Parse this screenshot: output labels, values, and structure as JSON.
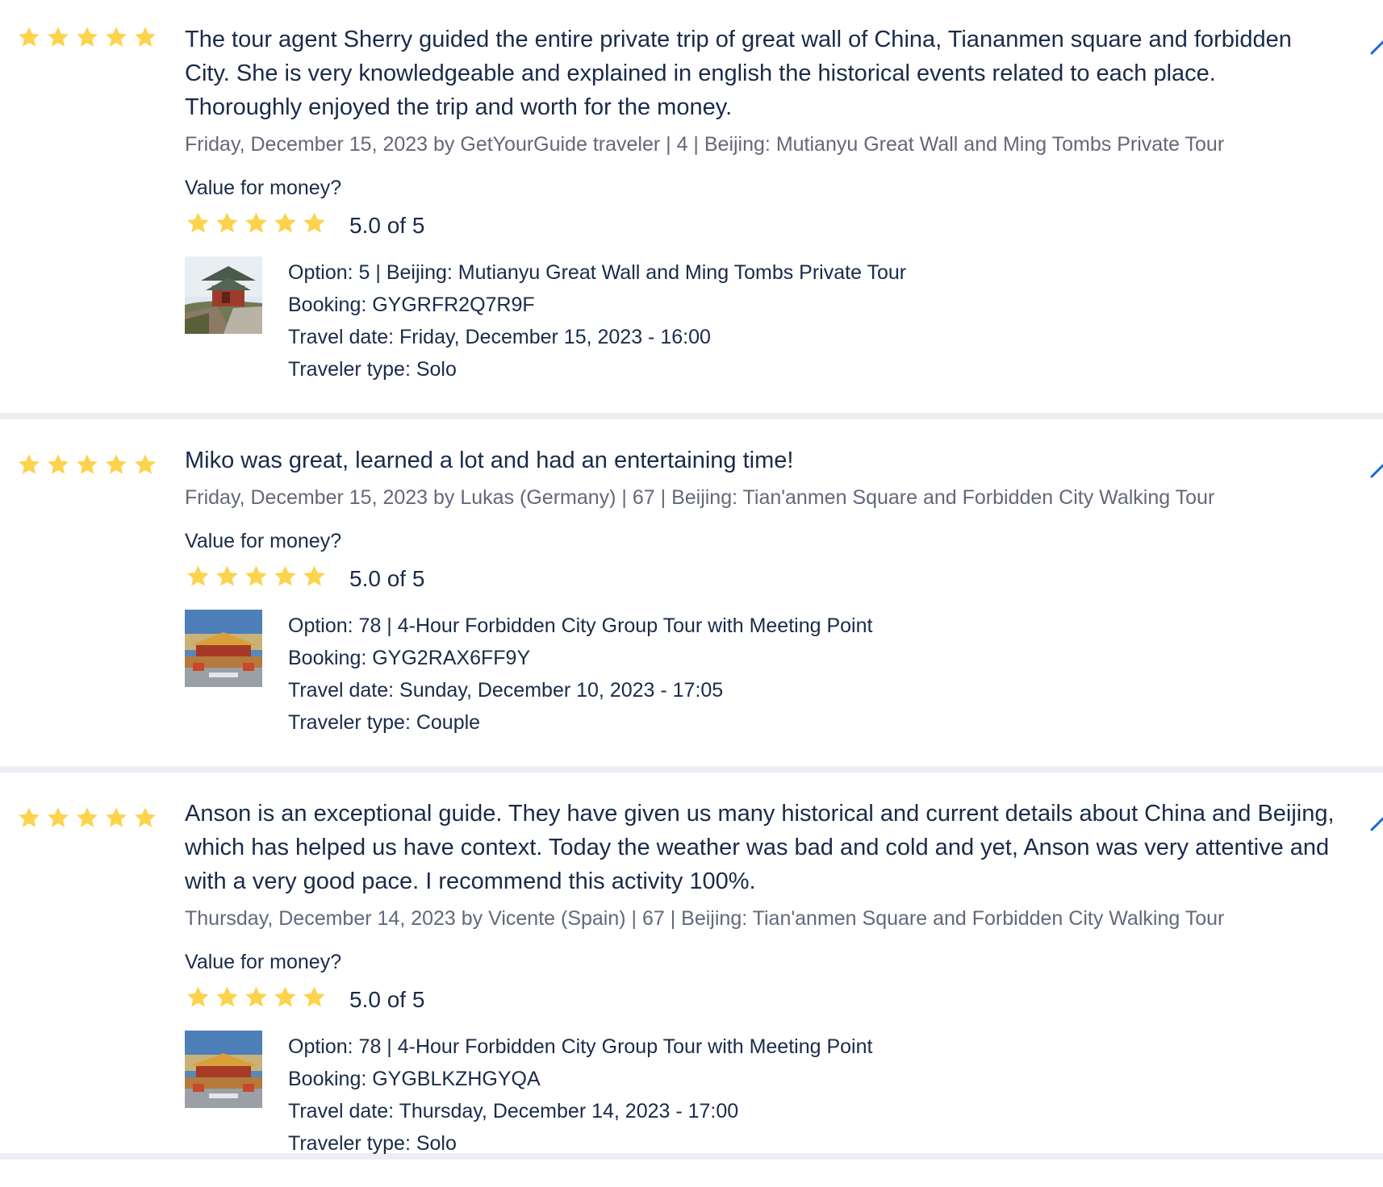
{
  "colors": {
    "star": "#fdd34d",
    "text": "#1a2b49",
    "meta": "#63687a",
    "divider": "#eceef3",
    "edit_accent": "#1a68d8"
  },
  "reviews": [
    {
      "rating": 5,
      "text": "The tour agent Sherry guided the entire private trip of great wall of China, Tiananmen square and forbidden City. She is very knowledgeable and explained in english the historical events related to each place. Thoroughly enjoyed the trip and worth for the money.",
      "meta": "Friday, December 15, 2023 by GetYourGuide traveler | 4 | Beijing: Mutianyu Great Wall and Ming Tombs Private Tour",
      "value_label": "Value for money?",
      "value_score": "5.0 of 5",
      "option": "Option: 5 | Beijing: Mutianyu Great Wall and Ming Tombs Private Tour",
      "booking": "Booking: GYGRFR2Q7R9F",
      "travel_date": "Travel date: Friday, December 15, 2023 - 16:00",
      "traveler_type": "Traveler type: Solo",
      "thumbnail_icon": "ming-tombs-photo"
    },
    {
      "rating": 5,
      "text": "Miko was great, learned a lot and had an entertaining time!",
      "meta": "Friday, December 15, 2023 by Lukas (Germany) | 67 | Beijing: Tian'anmen Square and Forbidden City Walking Tour",
      "value_label": "Value for money?",
      "value_score": "5.0 of 5",
      "option": "Option: 78 | 4-Hour Forbidden City Group Tour with Meeting Point",
      "booking": "Booking: GYG2RAX6FF9Y",
      "travel_date": "Travel date: Sunday, December 10, 2023 - 17:05",
      "traveler_type": "Traveler type: Couple",
      "thumbnail_icon": "forbidden-city-photo"
    },
    {
      "rating": 5,
      "text": "Anson is an exceptional guide. They have given us many historical and current details about China and Beijing, which has helped us have context. Today the weather was bad and cold and yet, Anson was very attentive and with a very good pace. I recommend this activity 100%.",
      "meta": "Thursday, December 14, 2023 by Vicente (Spain) | 67 | Beijing: Tian'anmen Square and Forbidden City Walking Tour",
      "value_label": "Value for money?",
      "value_score": "5.0 of 5",
      "option": "Option: 78 | 4-Hour Forbidden City Group Tour with Meeting Point",
      "booking": "Booking: GYGBLKZHGYQA",
      "travel_date": "Travel date: Thursday, December 14, 2023 - 17:00",
      "traveler_type": "Traveler type: Solo",
      "thumbnail_icon": "forbidden-city-photo"
    }
  ]
}
